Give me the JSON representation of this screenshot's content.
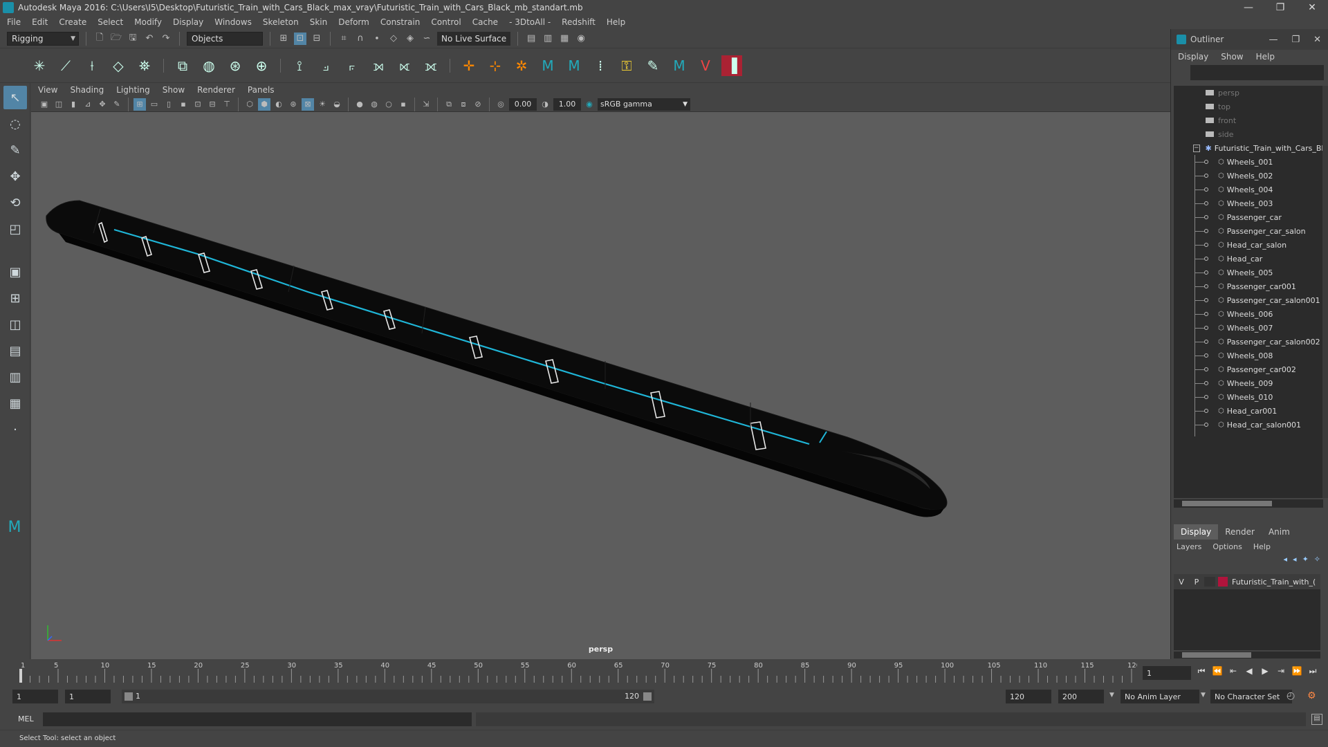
{
  "window": {
    "title": "Autodesk Maya 2016: C:\\Users\\I5\\Desktop\\Futuristic_Train_with_Cars_Black_max_vray\\Futuristic_Train_with_Cars_Black_mb_standart.mb",
    "minimize": "—",
    "restore": "❐",
    "close": "✕"
  },
  "menu": [
    "File",
    "Edit",
    "Create",
    "Select",
    "Modify",
    "Display",
    "Windows",
    "Skeleton",
    "Skin",
    "Deform",
    "Constrain",
    "Control",
    "Cache",
    "- 3DtoAll -",
    "Redshift",
    "Help"
  ],
  "statusline": {
    "menuset": "Rigging",
    "selection_mode": "Objects",
    "live_surface": "No Live Surface"
  },
  "panel": {
    "menu": [
      "View",
      "Shading",
      "Lighting",
      "Show",
      "Renderer",
      "Panels"
    ],
    "exposure": "0.00",
    "gamma": "1.00",
    "color_space": "sRGB gamma",
    "camera": "persp"
  },
  "outliner": {
    "title": "Outliner",
    "menu": [
      "Display",
      "Show",
      "Help"
    ],
    "cameras": [
      "persp",
      "top",
      "front",
      "side"
    ],
    "group": "Futuristic_Train_with_Cars_Bl",
    "children": [
      "Wheels_001",
      "Wheels_002",
      "Wheels_004",
      "Wheels_003",
      "Passenger_car",
      "Passenger_car_salon",
      "Head_car_salon",
      "Head_car",
      "Wheels_005",
      "Passenger_car001",
      "Passenger_car_salon001",
      "Wheels_006",
      "Wheels_007",
      "Passenger_car_salon002",
      "Wheels_008",
      "Passenger_car002",
      "Wheels_009",
      "Wheels_010",
      "Head_car001",
      "Head_car_salon001"
    ]
  },
  "layers": {
    "tabs": [
      "Display",
      "Render",
      "Anim"
    ],
    "menu": [
      "Layers",
      "Options",
      "Help"
    ],
    "rows": [
      {
        "v": "V",
        "p": "P",
        "name": "Futuristic_Train_with_(",
        "color": "#b0143c"
      }
    ]
  },
  "timeline": {
    "ticks": [
      "1",
      "5",
      "10",
      "15",
      "20",
      "25",
      "30",
      "35",
      "40",
      "45",
      "50",
      "55",
      "60",
      "65",
      "70",
      "75",
      "80",
      "85",
      "90",
      "95",
      "100",
      "105",
      "110",
      "115",
      "120"
    ],
    "current_frame": "1",
    "start_time": "1",
    "playback_start": "1",
    "range_start": "1",
    "range_end": "120",
    "playback_end": "120",
    "end_time": "200",
    "anim_layer": "No Anim Layer",
    "character_set": "No Character Set"
  },
  "command": {
    "mel": "MEL"
  },
  "help_line": "Select Tool: select an object"
}
